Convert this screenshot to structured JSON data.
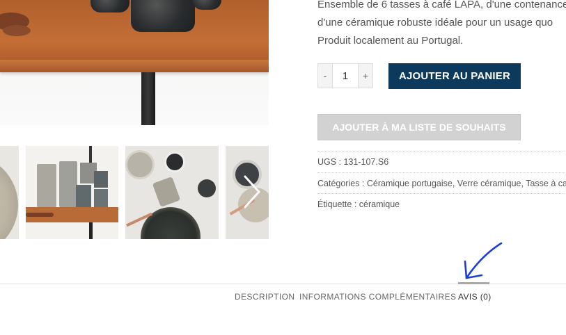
{
  "product": {
    "description_lines": [
      "Ensemble de 6 tasses à café LAPA, d'une contenance",
      "d'une céramique robuste idéale pour un usage quo",
      "Produit localement au Portugal."
    ],
    "quantity": {
      "minus_label": "-",
      "value": "1",
      "plus_label": "+"
    },
    "add_to_cart_label": "AJOUTER AU PANIER",
    "wishlist_label": "AJOUTER À MA LISTE DE SOUHAITS",
    "meta": {
      "sku": "UGS : 131-107.S6",
      "categories": "Catégories : Céramique portugaise, Verre céramique, Tasse à ca",
      "tag": "Étiquette : céramique"
    }
  },
  "tabs": [
    {
      "label": "DESCRIPTION"
    },
    {
      "label": "INFORMATIONS COMPLÉMENTAIRES"
    },
    {
      "label": "AVIS (0)",
      "active": true
    }
  ],
  "colors": {
    "primary_button": "#0d3a5c",
    "disabled_button": "#d2d2d2",
    "annotation_arrow": "#1a3fd6"
  },
  "icons": {
    "gallery_next": "chevron-right-icon",
    "annotation": "hand-drawn-arrow-icon"
  }
}
